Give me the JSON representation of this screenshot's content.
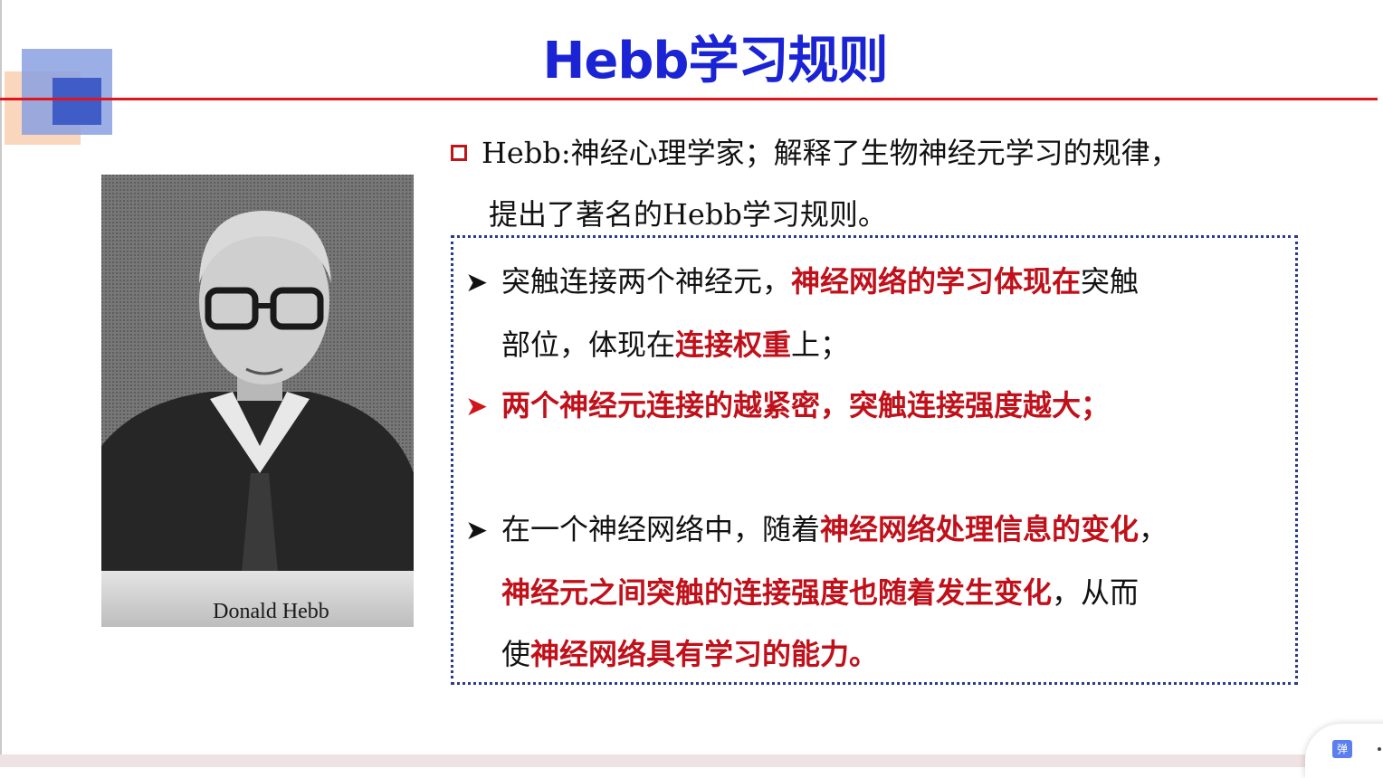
{
  "slide": {
    "title": "Hebb学习规则",
    "photo_caption": "Donald Hebb",
    "intro_line1": "Hebb:神经心理学家；解释了生物神经元学习的规律，",
    "intro_line2": "提出了著名的Hebb学习规则。",
    "bullet1": {
      "line1_plain_a": "突触连接两个神经元，",
      "line1_red": "神经网络的学习体现在",
      "line1_plain_b": "突触",
      "line2_plain_a": "部位，体现在",
      "line2_red": "连接权重",
      "line2_plain_b": "上；"
    },
    "bullet2": {
      "red": "两个神经元连接的越紧密，突触连接强度越大；"
    },
    "bullet3": {
      "line1_plain": "在一个神经网络中，随着",
      "line1_red": "神经网络处理信息的变化",
      "line1_end": "，",
      "line2_red": "神经元之间突触的连接强度也随着发生变化",
      "line2_plain": "，从而",
      "line3_plain": "使",
      "line3_red": "神经网络具有学习的能力。"
    }
  },
  "widget": {
    "icon_label": "弹"
  },
  "colors": {
    "title": "#1a24d4",
    "accent_red": "#c0101a",
    "rule_line": "#e0141c",
    "box_border": "#2b3a8c"
  },
  "icons": [
    "square-bullet-icon",
    "arrow-bullet-icon",
    "danmaku-icon"
  ]
}
